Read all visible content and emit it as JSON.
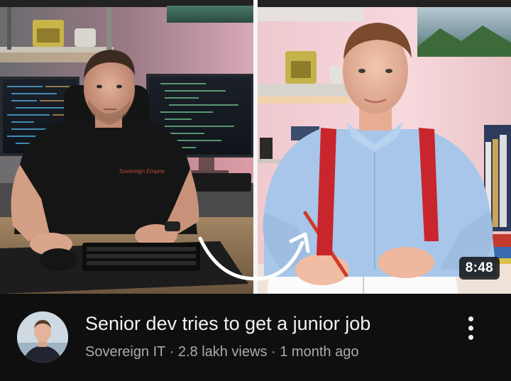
{
  "video": {
    "duration": "8:48",
    "title": "Senior dev tries to get a junior job",
    "channel": "Sovereign IT",
    "separator": "·",
    "views": "2.8 lakh views",
    "age": "1 month ago",
    "thumbnail_shirt_text": "Sovereign Empire"
  },
  "icons": {
    "menu": "more-vert-icon",
    "thumb_arrow": "curved-arrow-icon"
  },
  "colors": {
    "background": "#0f0f0f",
    "title": "#f1f1f1",
    "subtext": "#aaaaaa",
    "duration_bg": "#000000",
    "suspenders": "#c8262c",
    "shirt_left": "#151515",
    "shirt_right": "#a9c8ea"
  }
}
